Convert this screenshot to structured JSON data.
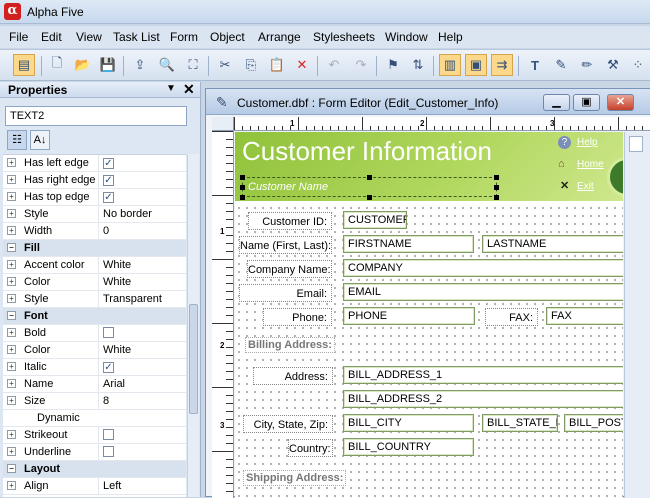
{
  "app": {
    "title": "Alpha Five",
    "logo": "α"
  },
  "menu": [
    "File",
    "Edit",
    "View",
    "Task List",
    "Form",
    "Object",
    "Arrange",
    "Stylesheets",
    "Window",
    "Help"
  ],
  "toolbar": {
    "icons": [
      "properties-icon",
      "new-icon",
      "open-icon",
      "save-icon",
      "export-icon",
      "preview-icon",
      "select-icon",
      "cut-icon",
      "copy-icon",
      "paste-icon",
      "delete-icon",
      "undo-icon",
      "redo-icon",
      "form-icon",
      "tab-order-icon",
      "layout-icon",
      "page-icon",
      "align-icon",
      "text-icon",
      "edit-icon",
      "pencil-icon",
      "magic-icon",
      "grid-icon"
    ]
  },
  "properties": {
    "title": "Properties",
    "object": "TEXT2",
    "rows": [
      {
        "type": "prop",
        "name": "Has left edge",
        "check": true
      },
      {
        "type": "prop",
        "name": "Has right edge",
        "check": true
      },
      {
        "type": "prop",
        "name": "Has top edge",
        "check": true
      },
      {
        "type": "prop",
        "name": "Style",
        "value": "No border"
      },
      {
        "type": "prop",
        "name": "Width",
        "value": "0"
      },
      {
        "type": "cat",
        "name": "Fill"
      },
      {
        "type": "prop",
        "name": "Accent color",
        "value": "White"
      },
      {
        "type": "prop",
        "name": "Color",
        "value": "White"
      },
      {
        "type": "prop",
        "name": "Style",
        "value": "Transparent"
      },
      {
        "type": "cat",
        "name": "Font"
      },
      {
        "type": "prop",
        "name": "Bold",
        "check": false
      },
      {
        "type": "prop",
        "name": "Color",
        "value": "White"
      },
      {
        "type": "prop",
        "name": "Italic",
        "check": true
      },
      {
        "type": "prop",
        "name": "Name",
        "value": "Arial"
      },
      {
        "type": "prop",
        "name": "Size",
        "value": "8"
      },
      {
        "type": "sub",
        "name": "Dynamic"
      },
      {
        "type": "prop",
        "name": "Strikeout",
        "check": false
      },
      {
        "type": "prop",
        "name": "Underline",
        "check": false
      },
      {
        "type": "cat",
        "name": "Layout"
      },
      {
        "type": "prop",
        "name": "Align",
        "value": "Left"
      }
    ]
  },
  "editor": {
    "title": "Customer.dbf : Form Editor (Edit_Customer_Info)",
    "ruler_h": [
      "1",
      "2",
      "3"
    ],
    "ruler_v": [
      "1",
      "2",
      "3"
    ],
    "header": {
      "title": "Customer Information",
      "subtitle": "Customer Name",
      "links": [
        "Help",
        "Home",
        "Exit"
      ],
      "colors": {
        "start": "#8fc23a",
        "end": "#cfe78e"
      }
    },
    "labels": {
      "customer_id": "Customer ID:",
      "name": "Name (First, Last):",
      "company": "Company Name:",
      "email": "Email:",
      "phone": "Phone:",
      "fax": "FAX:",
      "billing": "Billing Address:",
      "address": "Address:",
      "city_state_zip": "City, State, Zip:",
      "country": "Country:",
      "shipping": "Shipping Address:"
    },
    "fields": {
      "customer_id": "CUSTOMER_",
      "first": "FIRSTNAME",
      "last": "LASTNAME",
      "company": "COMPANY",
      "email": "EMAIL",
      "phone": "PHONE",
      "fax": "FAX",
      "addr1": "BILL_ADDRESS_1",
      "addr2": "BILL_ADDRESS_2",
      "city": "BILL_CITY",
      "state": "BILL_STATE_R",
      "postal": "BILL_POSTA",
      "country": "BILL_COUNTRY"
    }
  }
}
